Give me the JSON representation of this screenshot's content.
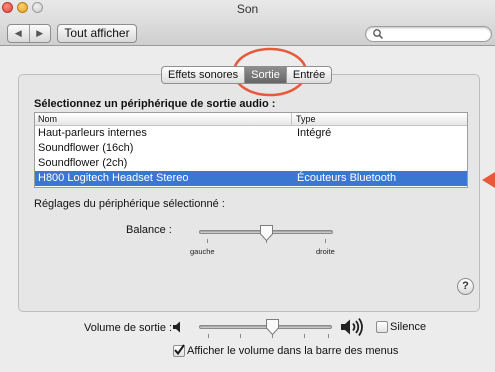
{
  "window": {
    "title": "Son"
  },
  "toolbar": {
    "back_icon": "back-arrow-icon",
    "forward_icon": "forward-arrow-icon",
    "show_all_label": "Tout afficher",
    "search_placeholder": ""
  },
  "tabs": [
    {
      "label": "Effets sonores",
      "selected": false
    },
    {
      "label": "Sortie",
      "selected": true
    },
    {
      "label": "Entrée",
      "selected": false
    }
  ],
  "output": {
    "heading": "Sélectionnez un périphérique de sortie audio :",
    "columns": [
      "Nom",
      "Type"
    ],
    "devices": [
      {
        "name": "Haut-parleurs internes",
        "type": "Intégré",
        "selected": false
      },
      {
        "name": "Soundflower (16ch)",
        "type": "",
        "selected": false
      },
      {
        "name": "Soundflower (2ch)",
        "type": "",
        "selected": false
      },
      {
        "name": "H800 Logitech Headset Stereo",
        "type": "Écouteurs Bluetooth",
        "selected": true
      }
    ],
    "settings_heading": "Réglages du périphérique sélectionné :",
    "balance": {
      "label": "Balance :",
      "left": "gauche",
      "right": "droite",
      "value": 0.5
    }
  },
  "volume": {
    "label": "Volume de sortie :",
    "level": 0.55,
    "mute_label": "Silence",
    "mute_checked": false,
    "menubar_label": "Afficher le volume dans la barre des menus",
    "menubar_checked": true
  },
  "help_label": "?",
  "colors": {
    "selection": "#3b76d3",
    "annotation": "#e8583a"
  }
}
